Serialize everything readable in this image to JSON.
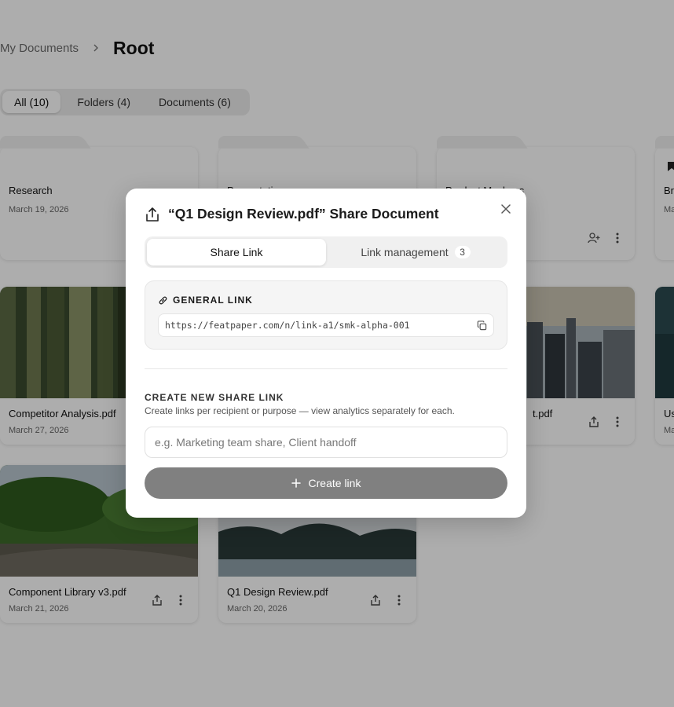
{
  "breadcrumb": {
    "parent": "My Documents",
    "current": "Root"
  },
  "filters": [
    {
      "label": "All (10)",
      "active": true
    },
    {
      "label": "Folders (4)",
      "active": false
    },
    {
      "label": "Documents (6)",
      "active": false
    }
  ],
  "cards": {
    "research": {
      "title": "Research",
      "date": "March 19, 2026"
    },
    "presentations": {
      "title": "Presentations",
      "date": ""
    },
    "product_mockups": {
      "title": "Product Mockups",
      "date": ""
    },
    "brand": {
      "title": "Br",
      "date": "Ma"
    },
    "competitor": {
      "title": "Competitor Analysis.pdf",
      "date": "March 27, 2026"
    },
    "city_doc": {
      "title": "t.pdf",
      "date": ""
    },
    "user_doc": {
      "title": "Us",
      "date": "Ma"
    },
    "component_library": {
      "title": "Component Library v3.pdf",
      "date": "March 21, 2026"
    },
    "q1_review": {
      "title": "Q1 Design Review.pdf",
      "date": "March 20, 2026"
    }
  },
  "modal": {
    "title": "“Q1 Design Review.pdf” Share Document",
    "tabs": {
      "share_link": "Share Link",
      "link_management": "Link management",
      "link_management_count": "3"
    },
    "general_link": {
      "label": "GENERAL LINK",
      "url": "https://featpaper.com/n/link-a1/smk-alpha-001"
    },
    "create": {
      "title": "CREATE NEW SHARE LINK",
      "description": "Create links per recipient or purpose — view analytics separately for each.",
      "placeholder": "e.g. Marketing team share, Client handoff",
      "button_label": "Create link"
    }
  },
  "colors": {
    "create_button": "#808080",
    "overlay": "rgba(0,0,0,0.32)"
  }
}
